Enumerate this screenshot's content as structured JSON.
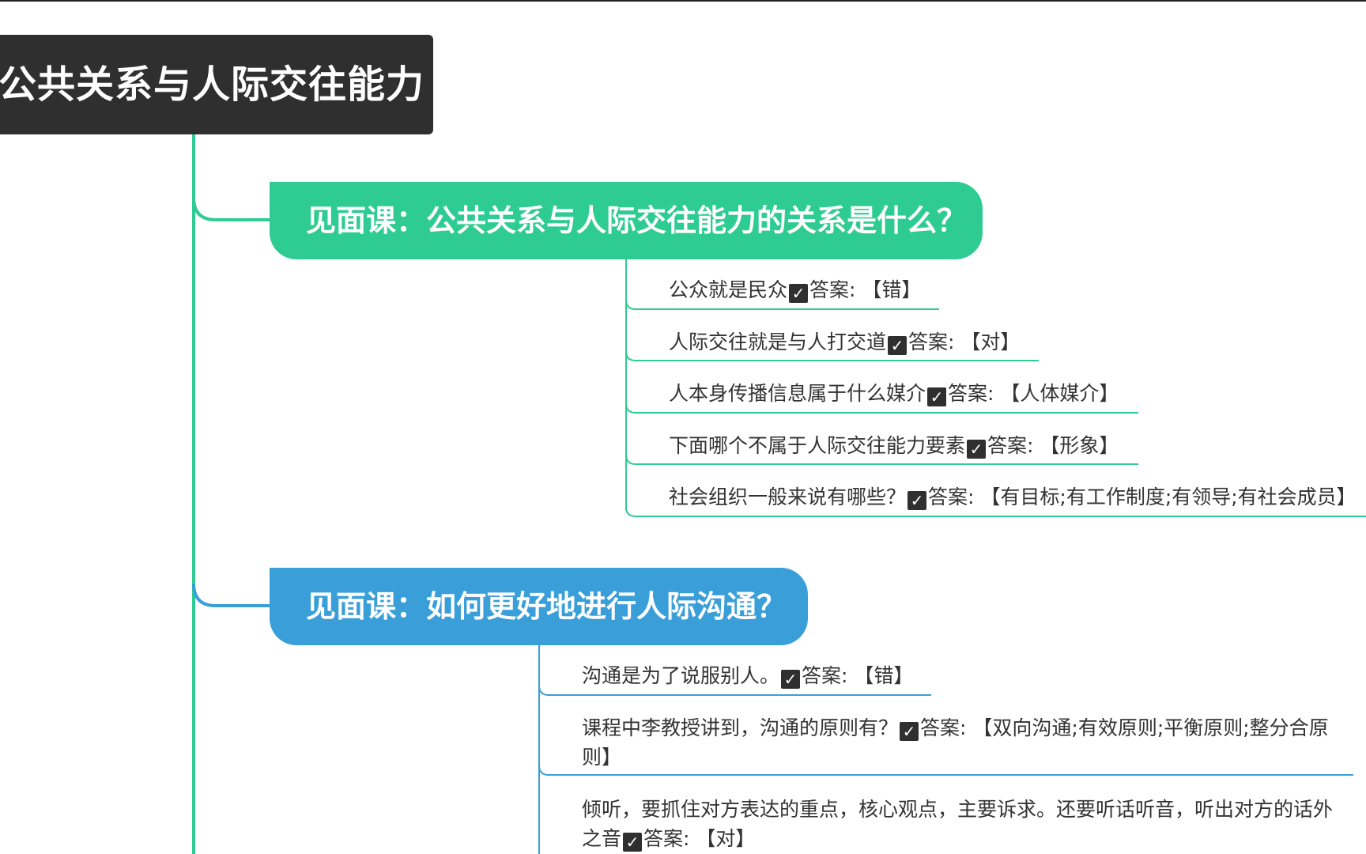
{
  "root": {
    "title": "公共关系与人际交往能力"
  },
  "colors": {
    "root": "#2f2f2f",
    "topic1": "#2ecc92",
    "topic2": "#3a9fd8"
  },
  "topics": [
    {
      "title": "见面课：公共关系与人际交往能力的关系是什么？",
      "items": [
        {
          "q": "公众就是民众",
          "answer_label": "答案:",
          "answer": "【错】"
        },
        {
          "q": "人际交往就是与人打交道",
          "answer_label": "答案:",
          "answer": "【对】"
        },
        {
          "q": "人本身传播信息属于什么媒介",
          "answer_label": "答案:",
          "answer": "【人体媒介】"
        },
        {
          "q": "下面哪个不属于人际交往能力要素",
          "answer_label": "答案:",
          "answer": "【形象】"
        },
        {
          "q": "社会组织一般来说有哪些？",
          "answer_label": "答案:",
          "answer": "【有目标;有工作制度;有领导;有社会成员】"
        }
      ]
    },
    {
      "title": "见面课：如何更好地进行人际沟通？",
      "items": [
        {
          "q": "沟通是为了说服别人。",
          "answer_label": "答案:",
          "answer": "【错】"
        },
        {
          "q": "课程中李教授讲到，沟通的原则有？",
          "answer_label": "答案:",
          "answer": "【双向沟通;有效原则;平衡原则;整分合原",
          "answer_cont": "则】"
        },
        {
          "q": "倾听，要抓住对方表达的重点，核心观点，主要诉求。还要听话听音，听出对方的话外",
          "q_cont": "之音",
          "answer_label": "答案:",
          "answer": "【对】"
        }
      ]
    }
  ],
  "icons": {
    "check": "checkbox-checked-icon"
  }
}
